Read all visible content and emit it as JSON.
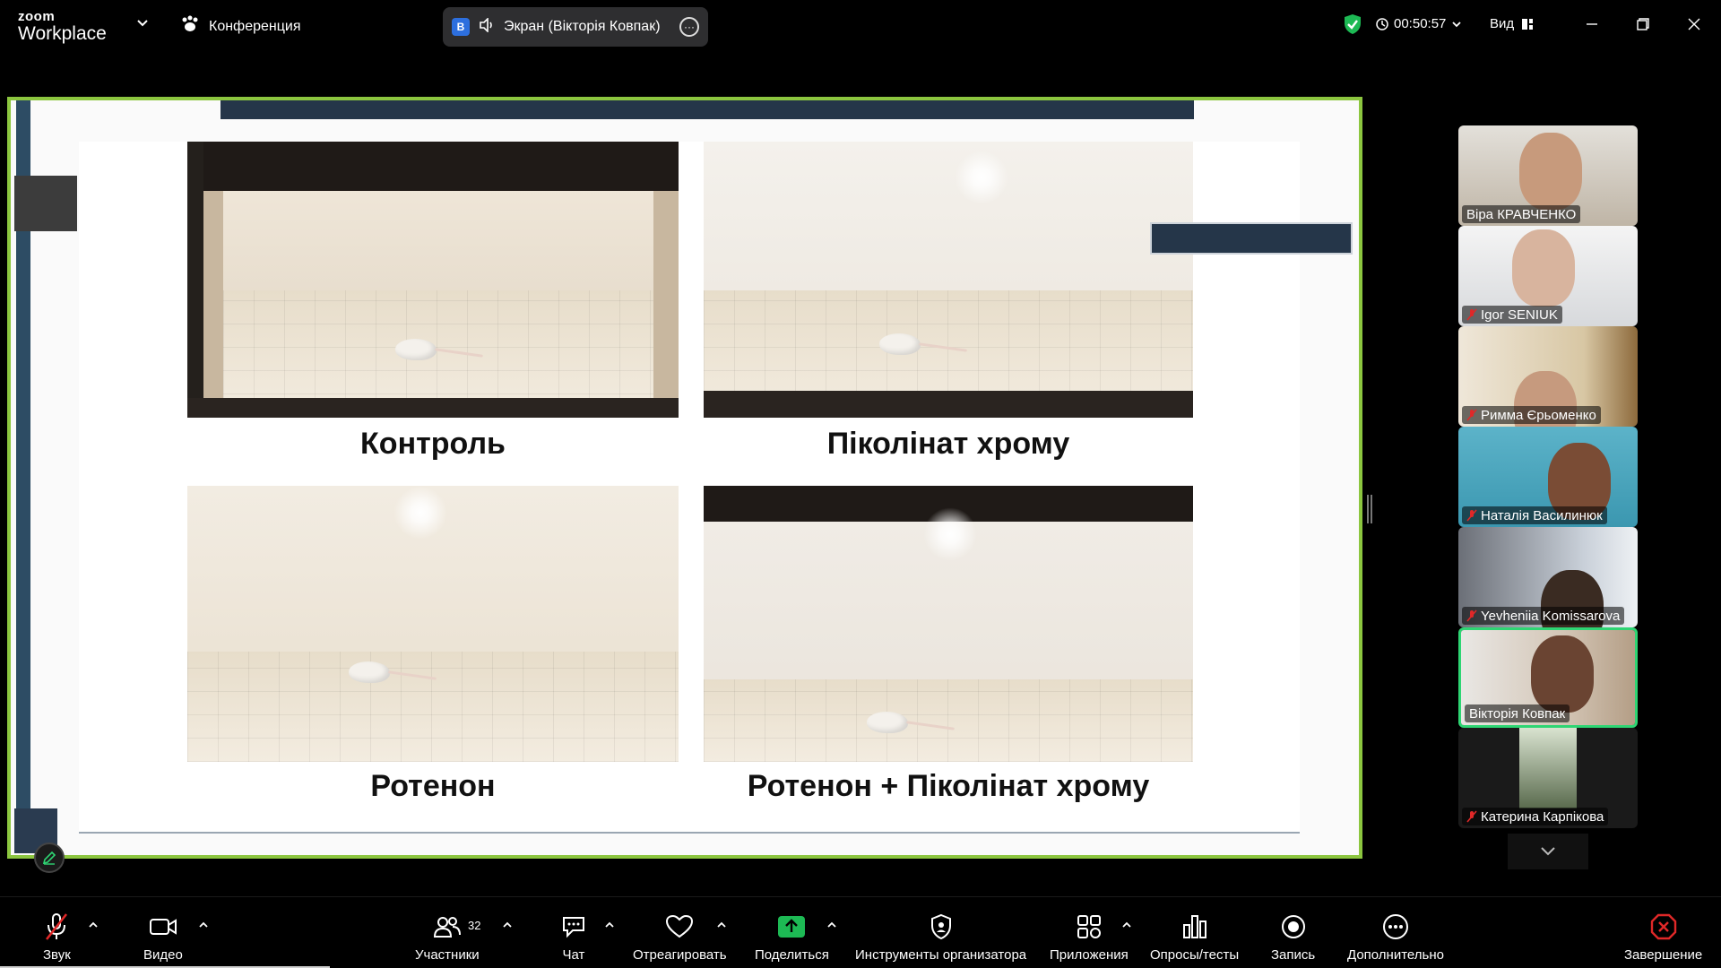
{
  "app": {
    "logo_top": "zoom",
    "logo_bottom": "Workplace"
  },
  "titlebar": {
    "meeting_label": "Конференция",
    "share_badge": "В",
    "share_label": "Экран (Вікторія Ковпак)",
    "timer": "00:50:57",
    "view_label": "Вид"
  },
  "slide": {
    "captions": [
      "Контроль",
      "Піколінат хрому",
      "Ротенон",
      "Ротенон + Піколінат хрому"
    ]
  },
  "participants": [
    {
      "name": "Віра КРАВЧЕНКО",
      "muted": false,
      "active": false
    },
    {
      "name": "Igor SENIUK",
      "muted": true,
      "active": false
    },
    {
      "name": "Римма Єрьоменко",
      "muted": true,
      "active": false
    },
    {
      "name": "Наталія Василинюк",
      "muted": true,
      "active": false
    },
    {
      "name": "Yevheniia Komissarova",
      "muted": true,
      "active": false
    },
    {
      "name": "Вікторія Ковпак",
      "muted": false,
      "active": true
    },
    {
      "name": "Катерина Карпікова",
      "muted": true,
      "active": false
    }
  ],
  "toolbar": {
    "audio": "Звук",
    "video": "Видео",
    "participants": "Участники",
    "participants_count": "32",
    "chat": "Чат",
    "react": "Отреагировать",
    "share": "Поделиться",
    "host_tools": "Инструменты организатора",
    "apps": "Приложения",
    "polls": "Опросы/тесты",
    "record": "Запись",
    "more": "Дополнительно",
    "end": "Завершение"
  },
  "colors": {
    "active_border": "#8cc63f",
    "share_green": "#1db954",
    "end_red": "#e02828",
    "speaker_border": "#2ed573"
  }
}
